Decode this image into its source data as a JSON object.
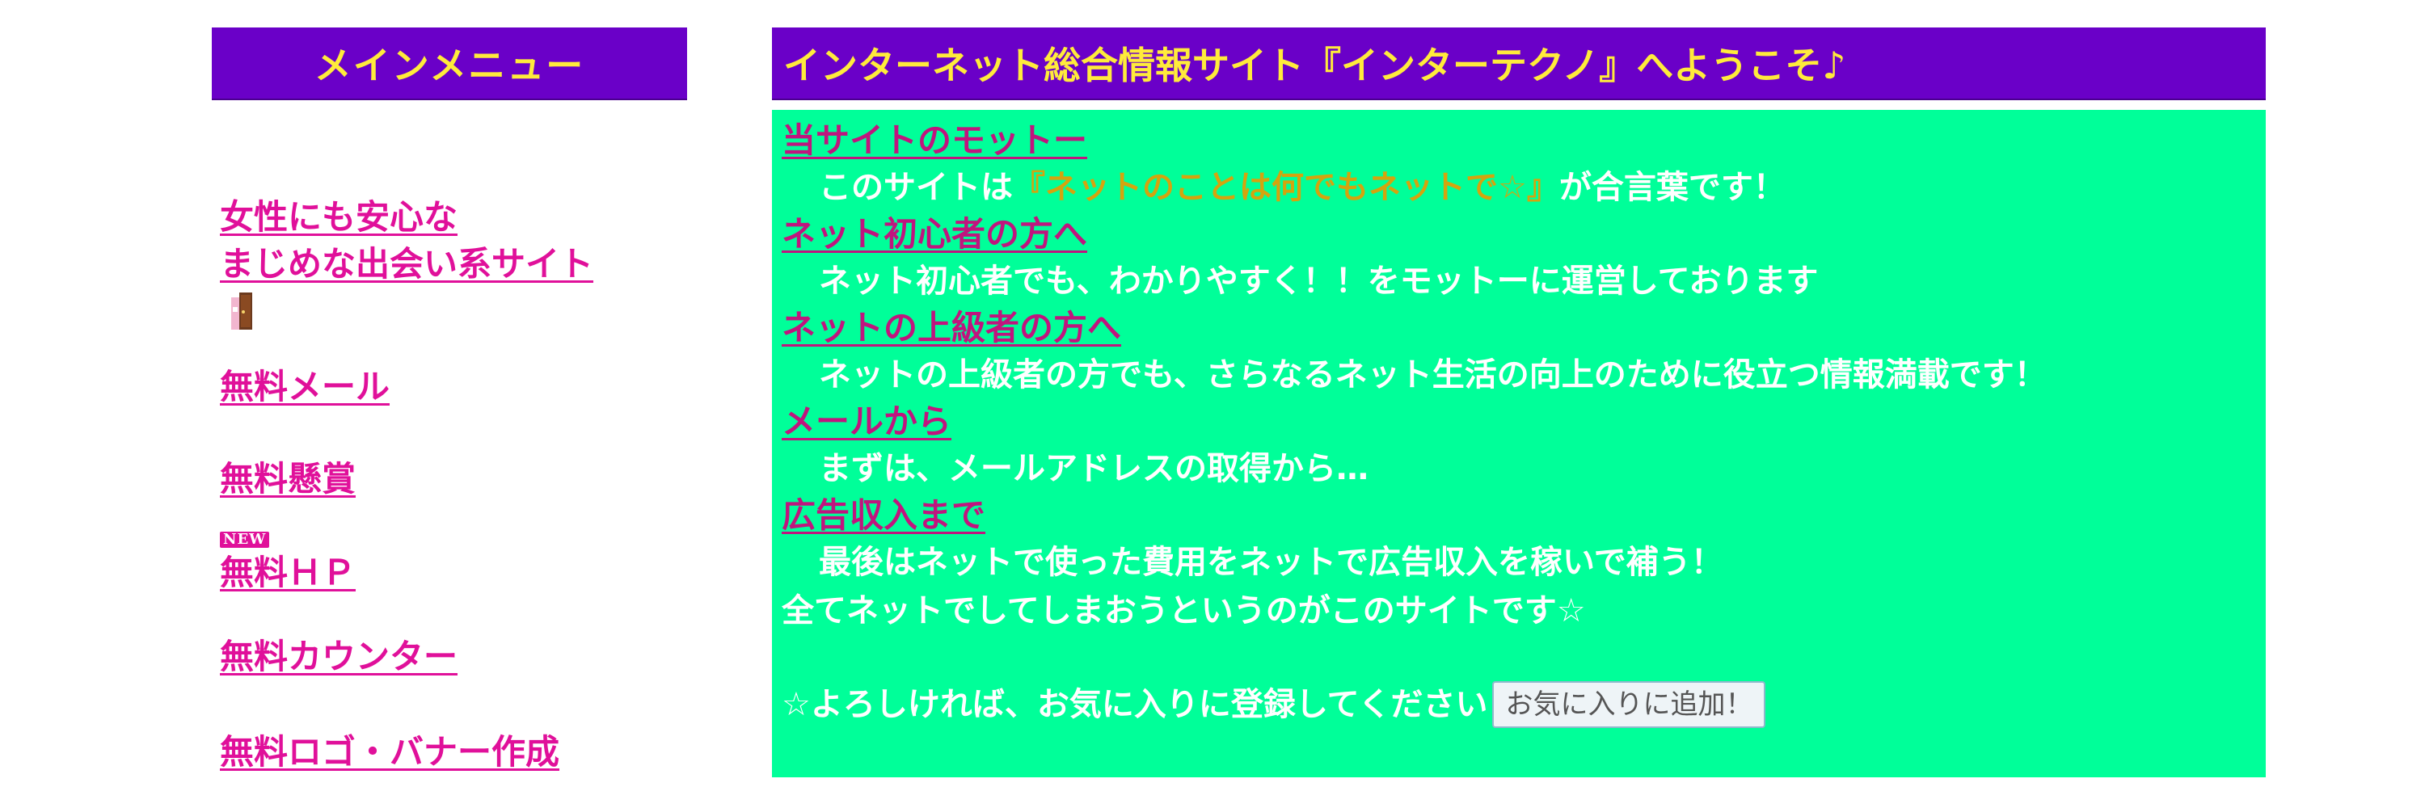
{
  "sidebar": {
    "title": "メインメニュー",
    "items": [
      {
        "line1": "女性にも安心な",
        "line2": "まじめな出会い系サイト",
        "icon": "door-icon"
      },
      {
        "label": "無料メール"
      },
      {
        "label": "無料懸賞"
      },
      {
        "label": "無料ＨＰ",
        "badge": "NEW"
      },
      {
        "label": "無料カウンター"
      },
      {
        "label": "無料ロゴ・バナー作成"
      }
    ]
  },
  "main": {
    "title": "インターネット総合情報サイト『インターテクノ』へようこそ♪",
    "sections": [
      {
        "heading": "当サイトのモットー",
        "text_before": "このサイトは",
        "highlight": "『ネットのことは何でもネットで☆』",
        "text_after": "が合言葉です！"
      },
      {
        "heading": "ネット初心者の方へ",
        "text": "ネット初心者でも、わかりやすく！！をモットーに運営しております"
      },
      {
        "heading": "ネットの上級者の方へ",
        "text": "ネットの上級者の方でも、さらなるネット生活の向上のために役立つ情報満載です！"
      },
      {
        "heading": "メールから",
        "text": "まずは、メールアドレスの取得から…"
      },
      {
        "heading": "広告収入まで",
        "text": "最後はネットで使った費用をネットで広告収入を稼いで補う！"
      }
    ],
    "closing": "全てネットでしてしまおうというのがこのサイトです☆",
    "bookmark_prompt": "☆よろしければ、お気に入りに登録してください",
    "bookmark_button": "お気に入りに追加！"
  },
  "colors": {
    "header_bg": "#6a00c8",
    "header_text": "#ffeb3b",
    "content_bg": "#00ff99",
    "link": "#e0109a",
    "motto_highlight": "#d4a40e"
  }
}
